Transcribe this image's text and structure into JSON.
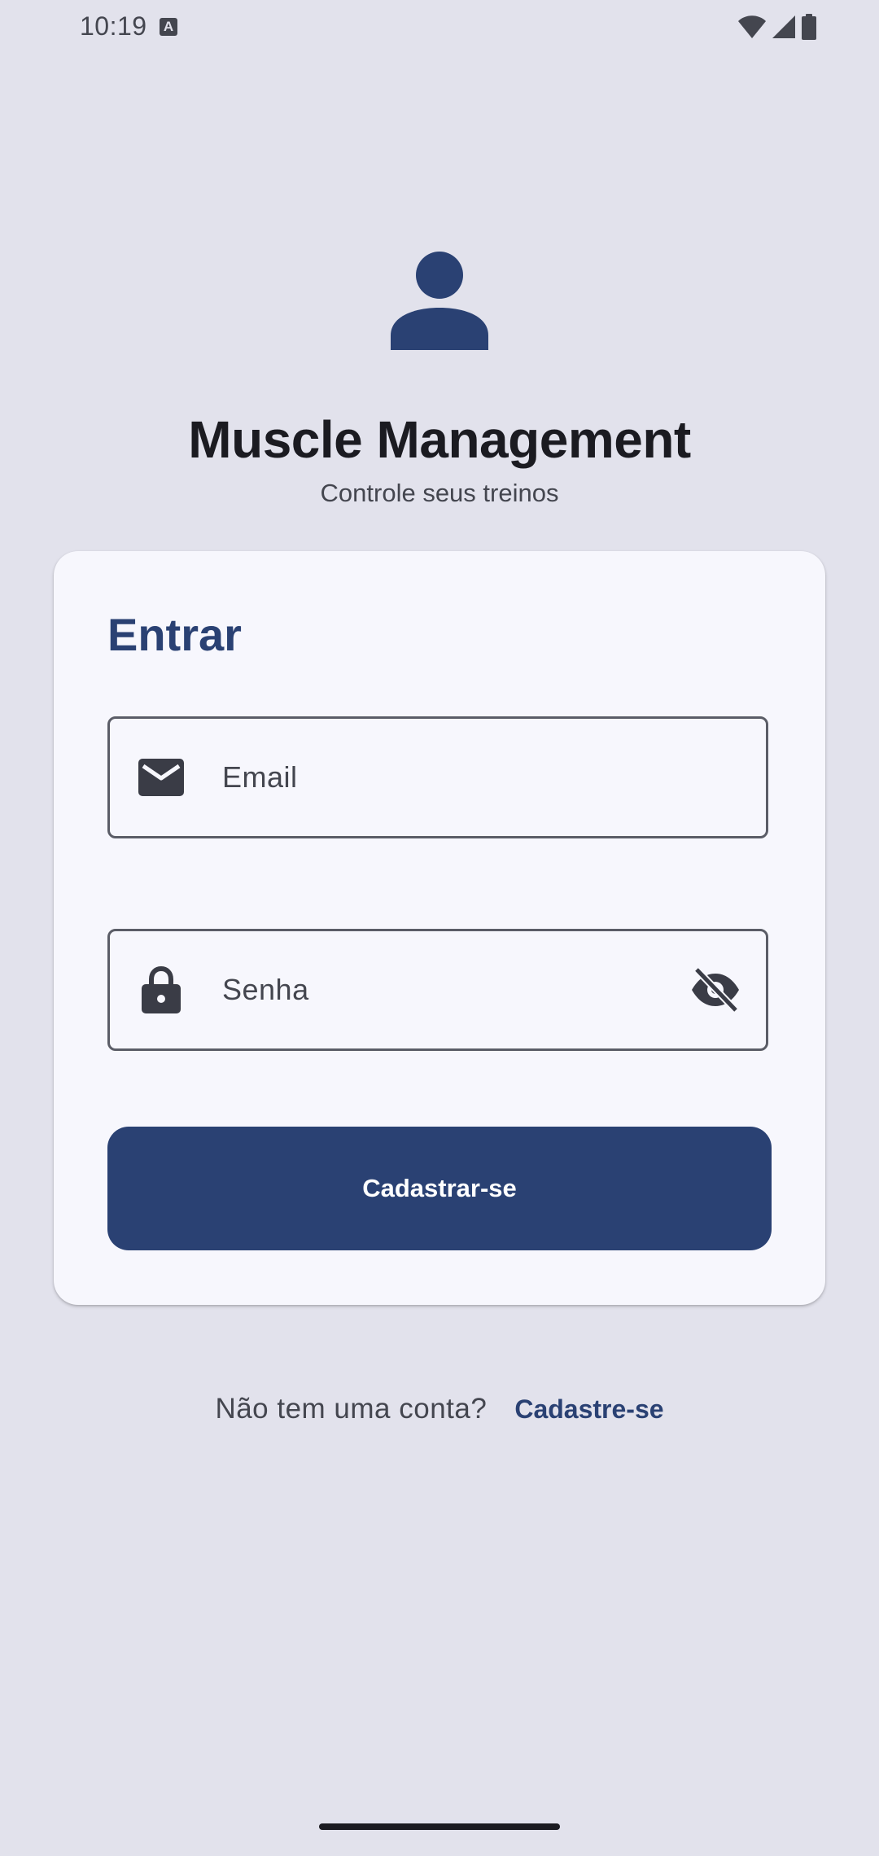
{
  "status_bar": {
    "time": "10:19",
    "notification_icon": "text-a-icon",
    "icons": [
      "wifi-icon",
      "signal-icon",
      "battery-icon"
    ]
  },
  "header": {
    "avatar_icon": "person-icon",
    "title": "Muscle Management",
    "subtitle": "Controle seus treinos"
  },
  "login_card": {
    "title": "Entrar",
    "email_field": {
      "placeholder": "Email",
      "icon": "mail-icon"
    },
    "password_field": {
      "placeholder": "Senha",
      "icon": "lock-icon",
      "toggle_icon": "visibility-off-icon"
    },
    "submit_label": "Cadastrar-se"
  },
  "footer": {
    "prompt": "Não tem uma conta?",
    "link": "Cadastre-se"
  },
  "colors": {
    "background": "#e2e2ec",
    "card": "#f7f7fd",
    "primary": "#2a4173",
    "text": "#1b1b21",
    "muted": "#44464f"
  }
}
